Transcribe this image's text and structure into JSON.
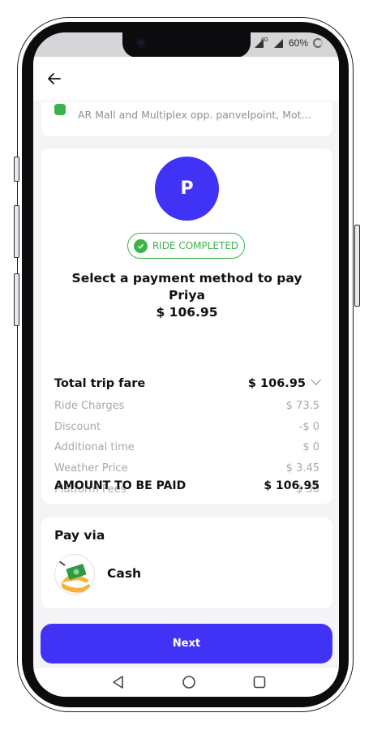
{
  "status": {
    "network": "4G",
    "battery": "60%"
  },
  "pickup": {
    "address": "AR Mall and Multiplex opp. panvelpoint, Mot..."
  },
  "driver": {
    "initial": "P",
    "name": "Priya"
  },
  "badge": {
    "label": "RIDE COMPLETED"
  },
  "payment": {
    "title_line1": "Select a payment method to pay",
    "amount": "$ 106.95"
  },
  "fare": {
    "total_label": "Total trip fare",
    "total_value": "$ 106.95",
    "items": [
      {
        "label": "Ride Charges",
        "value": "$ 73.5"
      },
      {
        "label": "Discount",
        "value": "-$ 0"
      },
      {
        "label": "Additional time",
        "value": "$ 0"
      },
      {
        "label": "Weather Price",
        "value": "$ 3.45"
      },
      {
        "label": "Platform Fees",
        "value": "$ 30"
      }
    ],
    "amount_label": "AMOUNT TO BE PAID",
    "amount_value": "$ 106.95"
  },
  "pay_via": {
    "title": "Pay via",
    "method": "Cash"
  },
  "next_button": {
    "label": "Next"
  },
  "colors": {
    "accent": "#4033f5",
    "success": "#3cb44b"
  },
  "icons": [
    "back-arrow-icon",
    "check-icon",
    "cash-icon",
    "nav-back-icon",
    "nav-home-icon",
    "nav-recents-icon"
  ]
}
